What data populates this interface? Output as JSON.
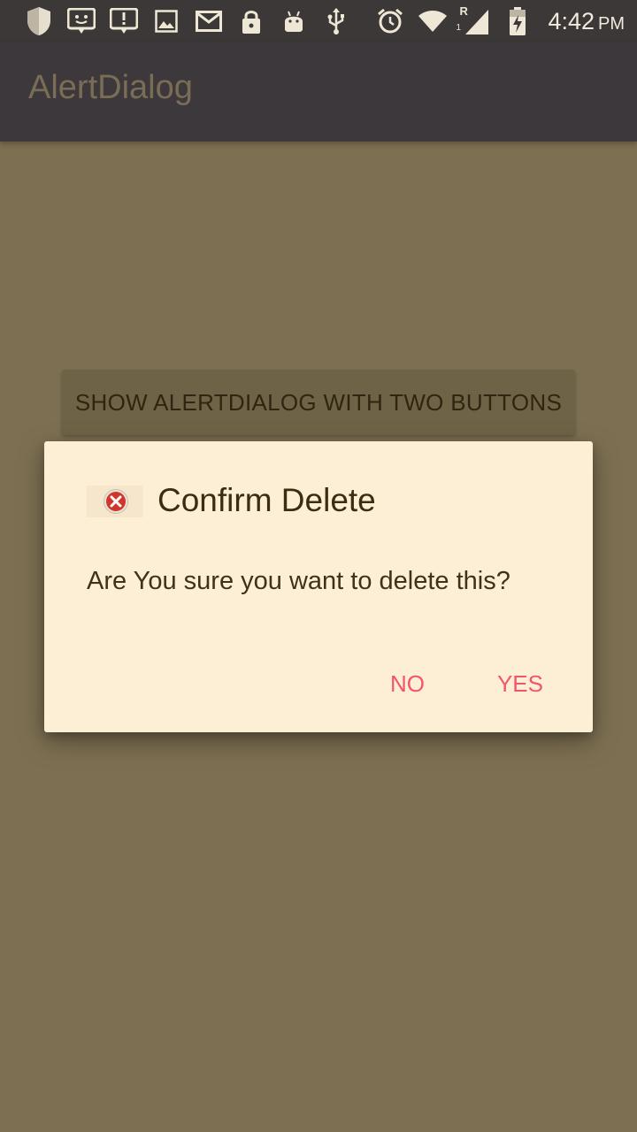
{
  "status_bar": {
    "time": "4:42",
    "ampm": "PM",
    "icons": [
      "shield-icon",
      "face-icon",
      "alert-icon",
      "image-icon",
      "gmail-icon",
      "lock-icon",
      "android-icon",
      "usb-icon",
      "alarm-icon",
      "wifi-icon",
      "signal-icon",
      "battery-charging-icon"
    ],
    "signal_roaming_label": "R",
    "signal_sim_label": "1"
  },
  "app_bar": {
    "title": "AlertDialog"
  },
  "main": {
    "show_button_label": "SHOW ALERTDIALOG WITH TWO BUTTONS"
  },
  "dialog": {
    "icon": "delete-error-icon",
    "title": "Confirm Delete",
    "message": "Are You sure you want to delete this?",
    "negative_label": "NO",
    "positive_label": "YES"
  },
  "colors": {
    "scrim_background": "#7d7052",
    "dialog_background": "#fcefd5",
    "accent": "#f2566e",
    "status_bar": "#3d3838"
  }
}
